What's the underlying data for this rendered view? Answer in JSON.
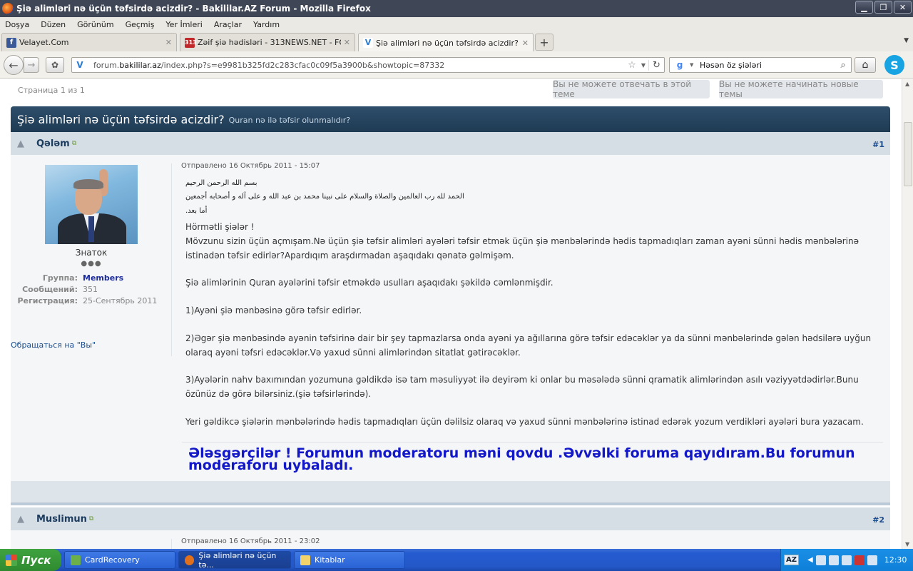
{
  "window": {
    "title": "Şiə alimləri nə üçün təfsirdə acizdir? - Bakililar.AZ Forum - Mozilla Firefox",
    "minimize": "▁",
    "maximize": "❐",
    "close": "✕"
  },
  "menu": [
    "Doşya",
    "Düzen",
    "Görünüm",
    "Geçmiş",
    "Yer İmleri",
    "Araçlar",
    "Yardım"
  ],
  "tabs": [
    {
      "label": "Velayet.Com",
      "favicon": "f"
    },
    {
      "label": "Zəif şiə hədisləri - 313NEWS.NET - FORUM",
      "favicon": "313"
    },
    {
      "label": "Şiə alimləri nə üçün təfsirdə acizdir? - Baki...",
      "favicon": "V"
    }
  ],
  "newtab": "+",
  "nav": {
    "url_prefix": "forum.",
    "url_domain": "bakililar.az",
    "url_suffix": "/index.php?s=e9981b325fd2c283cfac0c09f5a3900b&showtopic=87332",
    "site_icon": "V",
    "search_engine": "g",
    "search_query": "Həsən öz şiələri",
    "skype": "S"
  },
  "page": {
    "page_info": "Страница 1 из 1",
    "btn_reply": "Вы не можете отвечать в этой теме",
    "btn_new": "Вы не можете начинать новые темы",
    "topic_title": "Şiə alimləri nə üçün təfsirdə acizdir?",
    "topic_sub": "Quran nə ilə təfsir olunmalıdır?"
  },
  "post1": {
    "author": "Qələm",
    "num": "#1",
    "rank": "Знаток",
    "pips": "●●●",
    "group_k": "Группа:",
    "group_v": "Members",
    "posts_k": "Сообщений:",
    "posts_v": "351",
    "reg_k": "Регистрация:",
    "reg_v": "25-Сентябрь 2011",
    "contact": "Обращаться на \"Вы\"",
    "date": "Отправлено 16 Октябрь 2011 - 15:07",
    "ar1": "بسم الله الرحمن الرحيم",
    "ar2": "الحمد لله رب العالمين والصلاة والسلام على نبينا محمد بن عبد الله و على آله و أصحابه أجمعين",
    "ar3": "أما بعد.",
    "p1": "Hörmətli şiələr !",
    "p2": "Mövzunu sizin üçün açmışam.Nə üçün şiə təfsir alimləri ayələri təfsir etmək üçün şiə mənbələrində hədis tapmadıqları zaman ayəni sünni hədis mənbələrinə istinadən təfsir edirlər?Apardıqım araşdırmadan aşaqıdakı qənatə gəlmişəm.",
    "p3": "Şiə alimlərinin Quran ayələrini təfsir etməkdə usulları aşaqıdakı şəkildə cəmlənmişdir.",
    "p4": "1)Ayəni şiə mənbəsinə görə təfsir edirlər.",
    "p5": "2)Əgər şiə mənbəsində ayənin təfsirinə dair bir şey tapmazlarsa onda ayəni ya ağıllarına görə təfsir edəcəklər ya da sünni mənbələrində gələn hədsilərə uyğun olaraq ayəni təfsri edəcəklər.Və yaxud sünni alimlərindən sitatlat gətirəcəklər.",
    "p6": "3)Ayələrin nahv baxımından yozumuna gəldikdə isə tam məsuliyyət ilə deyirəm ki onlar bu məsələdə sünni qramatik alimlərindən asılı vəziyyətdədirlər.Bunu özünüz də görə bilərsiniz.(şiə təfsirlərində).",
    "p7": "Yeri gəldikcə şiələrin mənbələrində hədis tapmadıqları üçün dəlilsiz olaraq və yaxud sünni mənbələrinə istinad edərək yozum verdikləri ayələri bura yazacam.",
    "signature": "Ələsgərçilər ! Forumun moderatoru məni qovdu .Əvvəlki foruma qayıdıram.Bu forumun moderaforu uybaladı."
  },
  "post2": {
    "author": "Muslimun",
    "num": "#2",
    "date": "Отправлено 16 Октябрь 2011 - 23:02"
  },
  "taskbar": {
    "start": "Пуск",
    "items": [
      "CardRecovery",
      "Şiə alimləri nə üçün tə...",
      "Kitablar"
    ],
    "lang": "AZ",
    "clock": "12:30"
  }
}
